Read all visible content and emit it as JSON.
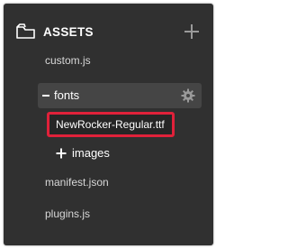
{
  "panel": {
    "title": "ASSETS",
    "header_icon": "folder-icon",
    "add_icon": "plus-icon"
  },
  "files": {
    "custom_js": "custom.js",
    "manifest_json": "manifest.json",
    "plugins_js": "plugins.js"
  },
  "folders": {
    "fonts": {
      "label": "fonts",
      "state": "expanded",
      "toggle_icon": "minus-icon",
      "settings_icon": "gear-icon",
      "children": [
        "NewRocker-Regular.ttf"
      ]
    },
    "images": {
      "label": "images",
      "state": "collapsed",
      "toggle_icon": "plus-icon"
    }
  },
  "colors": {
    "panel_bg": "#303030",
    "highlight_border": "#e0213a",
    "folder_row_bg": "#454545"
  }
}
